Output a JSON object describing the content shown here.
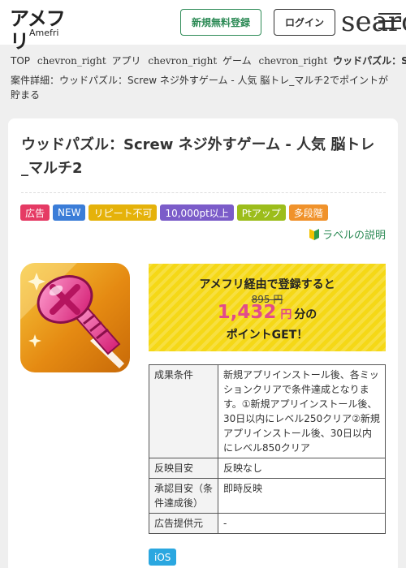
{
  "header": {
    "logo_main": "アメフリ",
    "logo_sub": "Amefri",
    "register_label": "新規無料登録",
    "login_label": "ログイン",
    "search_text": "search",
    "menu_icon": "hamburger-menu-icon"
  },
  "breadcrumb": {
    "items": [
      {
        "label": "TOP"
      },
      {
        "chevron": "chevron_right",
        "label": "アプリ"
      },
      {
        "chevron": "chevron_right",
        "label": "ゲーム"
      },
      {
        "chevron": "chevron_right",
        "label": "ウッドパズル：Screw ネジ外すゲ"
      }
    ]
  },
  "page_description": "案件詳細：ウッドパズル：Screw ネジ外すゲーム - 人気 脳トレ_マルチ2でポイントが貯まる",
  "offer": {
    "title": "ウッドパズル：Screw ネジ外すゲーム - 人気 脳トレ_マルチ2",
    "tags": [
      {
        "label": "広告",
        "color": "#e53a64"
      },
      {
        "label": "NEW",
        "color": "#3b7dd8"
      },
      {
        "label": "リピート不可",
        "color": "#e5b20a"
      },
      {
        "label": "10,000pt以上",
        "color": "#7b5cc9"
      },
      {
        "label": "Ptアップ",
        "color": "#9cbd1b"
      },
      {
        "label": "多段階",
        "color": "#f0922b"
      }
    ],
    "label_help": "ラベルの説明",
    "promo": {
      "line1": "アメフリ経由で登録すると",
      "old_price": "895 円",
      "points": "1,432",
      "yen": "円",
      "suffix": "分の",
      "line3": "ポイントGET！"
    },
    "table": [
      {
        "header": "成果条件",
        "value": "新規アプリインストール後、各ミッションクリアで条件達成となります。①新規アプリインストール後、30日以内にレベル250クリア②新規アプリインストール後、30日以内にレベル850クリア"
      },
      {
        "header": "反映目安",
        "value": "反映なし"
      },
      {
        "header": "承認目安（条件達成後）",
        "value": "即時反映"
      },
      {
        "header": "広告提供元",
        "value": "-"
      }
    ],
    "os": "iOS"
  },
  "colors": {
    "accent_green": "#2e8b57",
    "promo_yellow": "#f5d816",
    "points_pink": "#e24b8a",
    "ios_blue": "#2aa7e0"
  }
}
